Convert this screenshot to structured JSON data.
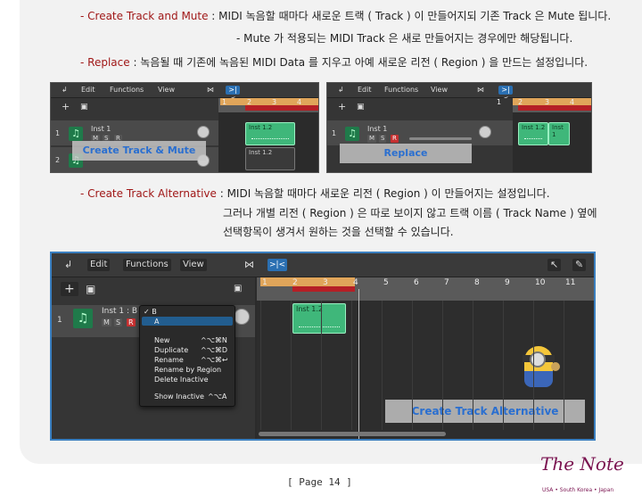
{
  "text": {
    "l1_red": "- Create Track and Mute",
    "l1_rest": " : MIDI 녹음할 때마다 새로운 트랙 ( Track ) 이 만들어지되 기존 Track 은 Mute 됩니다.",
    "l2": "- Mute 가 적용되는 MIDI Track 은 새로 만들어지는 경우에만 해당됩니다.",
    "l3_red": "- Replace",
    "l3_rest": " : 녹음될 때 기존에 녹음된 MIDI Data 를 지우고 아예 새로운 리전 ( Region ) 을 만드는 설정입니다.",
    "l4_red": "- Create Track Alternative",
    "l4_rest": " : MIDI 녹음할 때마다 새로운 리전 ( Region ) 이 만들어지는 설정입니다.",
    "l5": "그러나 개별 리전 ( Region ) 은 따로 보이지 않고 트랙 이름 ( Track Name ) 옆에",
    "l6": "선택항목이 생겨서 원하는 것을 선택할 수 있습니다."
  },
  "toolbar": {
    "edit": "Edit",
    "functions": "Functions",
    "view": "View",
    "chev": "⌄",
    "catch": "↲",
    "midi_in": "⋈",
    "snap": ">|<",
    "plus": "+",
    "dup": "▣",
    "pointer": "↖",
    "pencil": "✎"
  },
  "shot1": {
    "track1": "Inst 1",
    "track2": "Inst 1",
    "m": "M",
    "s": "S",
    "r": "R",
    "region1": "Inst 1.2",
    "region2": "Inst 1.2",
    "overlay": "Create Track & Mute",
    "ruler": [
      "1",
      "2",
      "3",
      "4"
    ],
    "row1": "1",
    "row2": "2"
  },
  "shot2": {
    "track": "Inst 1",
    "m": "M",
    "s": "S",
    "r": "R",
    "region1": "Inst 1.2",
    "region2": "Inst 1",
    "overlay": "Replace",
    "ruler": [
      "1",
      "2",
      "3",
      "4"
    ],
    "row1": "1"
  },
  "shot3": {
    "track": "Inst 1 : B",
    "m": "M",
    "s": "S",
    "r": "R",
    "region": "Inst 1.2",
    "overlay": "Create Track Alternative",
    "ruler": [
      "1",
      "2",
      "3",
      "4",
      "5",
      "6",
      "7",
      "8",
      "9",
      "10",
      "11"
    ],
    "row1": "1",
    "menu": {
      "b": "✓ B",
      "a": "A",
      "new": "New",
      "new_sc": "^⌥⌘N",
      "duplicate": "Duplicate",
      "duplicate_sc": "^⌥⌘D",
      "rename": "Rename",
      "rename_sc": "^⌥⌘↩",
      "rename_region": "Rename by Region",
      "delete_inactive": "Delete Inactive",
      "show_inactive": "Show Inactive",
      "show_inactive_sc": "^⌥A"
    }
  },
  "footer": {
    "page": "[ Page 14 ]",
    "logo": "The Note",
    "logo_sub": "USA • South Korea • Japan"
  }
}
